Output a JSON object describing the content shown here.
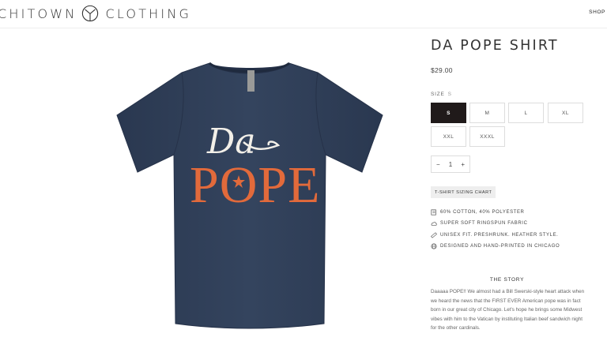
{
  "header": {
    "brand_left": "CHITOWN",
    "brand_right": "CLOTHING",
    "nav_shop": "SHOP"
  },
  "product": {
    "title": "DA POPE SHIRT",
    "price": "$29.00",
    "image": {
      "shirt_text_line1": "Da",
      "shirt_text_line2": "POPE",
      "shirt_color": "#2f3e55",
      "print_orange": "#e26a3b",
      "print_white": "#f2efe8"
    },
    "size": {
      "label": "SIZE",
      "selected": "S",
      "options": [
        "S",
        "M",
        "L",
        "XL",
        "XXL",
        "XXXL"
      ]
    },
    "quantity": {
      "minus": "−",
      "value": "1",
      "plus": "+"
    },
    "sizing_chart_label": "T-SHIRT SIZING CHART",
    "features": [
      {
        "icon": "tag-icon",
        "text": "60% COTTON, 40% POLYESTER"
      },
      {
        "icon": "cloud-icon",
        "text": "SUPER SOFT RINGSPUN FABRIC"
      },
      {
        "icon": "ruler-icon",
        "text": "UNISEX FIT. PRESHRUNK. HEATHER STYLE."
      },
      {
        "icon": "globe-icon",
        "text": "DESIGNED AND HAND-PRINTED IN CHICAGO"
      }
    ],
    "story": {
      "title": "THE STORY",
      "text": "Daaaaa POPE!! We almost had a Bill Swerski-style heart attack when we heard the news that the FIRST EVER American pope was in fact born in our great city of Chicago. Let's hope he brings some Midwest vibes with him to the Vatican by instituting Italian beef sandwich night for the other cardinals."
    }
  },
  "colors": {
    "selected_size_bg": "#201a1a",
    "chart_button_bg": "#eeeeee"
  }
}
